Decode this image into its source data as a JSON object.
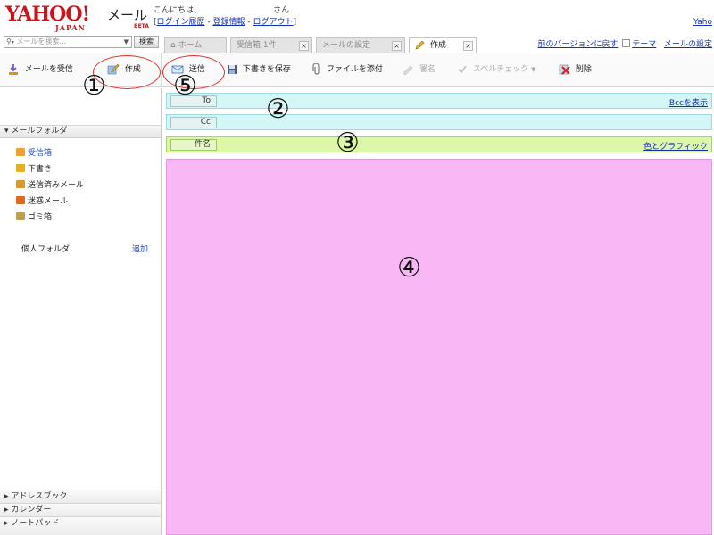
{
  "header": {
    "logo": "YAHOO!",
    "logo_sub": "JAPAN",
    "app_name": "メール",
    "beta": "BETA",
    "greeting": "こんにちは、",
    "greeting_suffix": "さん",
    "links": [
      "ログイン履歴",
      "登録情報",
      "ログアウト"
    ],
    "top_right_link": "Yaho"
  },
  "search": {
    "placeholder": "メールを検索...",
    "button": "検索"
  },
  "tabs": [
    {
      "label": "ホーム",
      "closable": false,
      "active": false
    },
    {
      "label": "受信箱 1件",
      "closable": true,
      "active": false
    },
    {
      "label": "メールの設定",
      "closable": true,
      "active": false
    },
    {
      "label": "作成",
      "closable": true,
      "active": true
    }
  ],
  "top_links": {
    "prev_version": "前のバージョンに戻す",
    "theme": "テーマ",
    "mail_settings": "メールの設定"
  },
  "toolbar": {
    "receive": "メールを受信",
    "compose": "作成",
    "send": "送信",
    "save_draft": "下書きを保存",
    "attach": "ファイルを添付",
    "signature": "署名",
    "spellcheck": "スペルチェック",
    "delete": "削除"
  },
  "sidebar": {
    "folder_header": "メールフォルダ",
    "folders": [
      {
        "label": "受信箱",
        "icon": "inbox-icon",
        "color": "#f0a030",
        "selected": true
      },
      {
        "label": "下書き",
        "icon": "drafts-icon",
        "color": "#e8b020",
        "selected": false
      },
      {
        "label": "送信済みメール",
        "icon": "sent-icon",
        "color": "#d89a30",
        "selected": false
      },
      {
        "label": "迷惑メール",
        "icon": "spam-icon",
        "color": "#e06a20",
        "selected": false
      },
      {
        "label": "ゴミ箱",
        "icon": "trash-icon",
        "color": "#c0a050",
        "selected": false
      }
    ],
    "personal_folders": "個人フォルダ",
    "add": "追加",
    "bottom": [
      "アドレスブック",
      "カレンダー",
      "ノートパッド"
    ]
  },
  "compose": {
    "to_label": "To:",
    "cc_label": "Cc:",
    "subject_label": "件名:",
    "show_bcc": "Bccを表示",
    "color_graphics": "色とグラフィック"
  },
  "annotations": [
    "①",
    "②",
    "③",
    "④",
    "⑤"
  ],
  "colors": {
    "recipient_rows": "#d5f6f7",
    "subject_row": "#dcf7a8",
    "body": "#f8b8f5",
    "annotation_ring": "#e0302e",
    "link": "#1530b0"
  }
}
